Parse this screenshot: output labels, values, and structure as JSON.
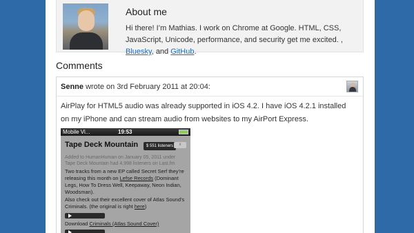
{
  "about": {
    "title": "About me",
    "text_before": "Hi there! I’m Mathias. I work on Chrome at Google. HTML, CSS, JavaScript, Unicode, performance, and security get me excited. ,",
    "link_bluesky": "Bluesky",
    "text_mid": ", and",
    "link_github": "GitHub",
    "text_after": "."
  },
  "comments": {
    "heading": "Comments",
    "items": [
      {
        "author": "Senne",
        "meta": " wrote on 3rd February 2011 at 20:04:",
        "text": "AirPlay for HTML5 audio was already supported in iOS 4.2. I have iOS 4.2.1 installed on my iPhone and can stream audio from websites to my AirPort Express.",
        "screenshot": {
          "carrier": "Mobile Vi...",
          "time": "19:53",
          "title": "Tape Deck Mountain",
          "listeners": "$ 551 listeners",
          "close": "x",
          "added": "Added to HumanHuman on January 05, 2011 under Tape Deck Mountain had 4,998 listeners on Last.fm",
          "paragraph1_pre": "Two tracks from a new EP called Secret Serf they’re releasing this month on ",
          "paragraph1_link": "Lefse Records",
          "paragraph1_post": " (Dominant Legs, How To Dress Well, Keepaway, Neon Indian, Woodsman).",
          "paragraph2_pre": "Also check out their excellent cover of Atlas Sound’s Criminals. (the original is right ",
          "paragraph2_link": "here",
          "paragraph2_post": ")",
          "download_pre": "Download ",
          "download_link": "Criminals (Atlas Sound Cover)"
        }
      }
    ]
  }
}
